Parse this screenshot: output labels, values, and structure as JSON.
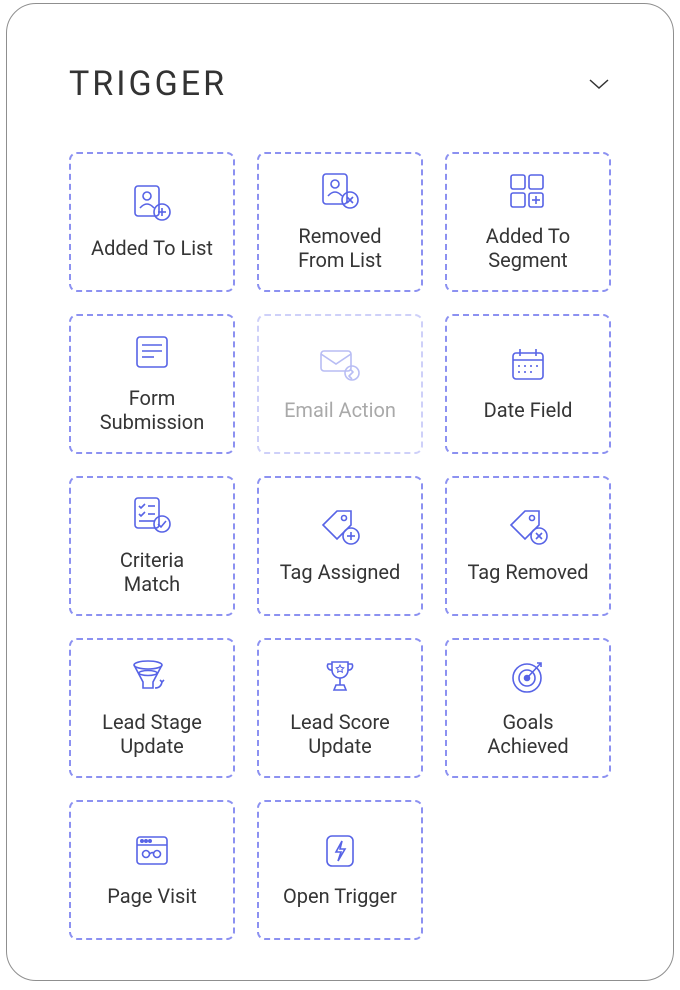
{
  "header": {
    "title": "TRIGGER"
  },
  "colors": {
    "border_dashed": "#8c91f1",
    "icon": "#5763e6",
    "text": "#353535"
  },
  "triggers": [
    {
      "id": "added-to-list",
      "icon": "user-list-add",
      "label": "Added To List",
      "disabled": false
    },
    {
      "id": "removed-from-list",
      "icon": "user-list-remove",
      "label": "Removed\nFrom List",
      "disabled": false
    },
    {
      "id": "added-to-segment",
      "icon": "segment-add",
      "label": "Added To\nSegment",
      "disabled": false
    },
    {
      "id": "form-submission",
      "icon": "form",
      "label": "Form\nSubmission",
      "disabled": false
    },
    {
      "id": "email-action",
      "icon": "email-action",
      "label": "Email Action",
      "disabled": true
    },
    {
      "id": "date-field",
      "icon": "calendar",
      "label": "Date Field",
      "disabled": false
    },
    {
      "id": "criteria-match",
      "icon": "criteria",
      "label": "Criteria\nMatch",
      "disabled": false
    },
    {
      "id": "tag-assigned",
      "icon": "tag-add",
      "label": "Tag Assigned",
      "disabled": false
    },
    {
      "id": "tag-removed",
      "icon": "tag-remove",
      "label": "Tag Removed",
      "disabled": false
    },
    {
      "id": "lead-stage-update",
      "icon": "funnel",
      "label": "Lead Stage\nUpdate",
      "disabled": false
    },
    {
      "id": "lead-score-update",
      "icon": "trophy",
      "label": "Lead Score\nUpdate",
      "disabled": false
    },
    {
      "id": "goals-achieved",
      "icon": "target",
      "label": "Goals\nAchieved",
      "disabled": false
    },
    {
      "id": "page-visit",
      "icon": "browser",
      "label": "Page Visit",
      "disabled": false
    },
    {
      "id": "open-trigger",
      "icon": "bolt",
      "label": "Open Trigger",
      "disabled": false
    }
  ]
}
